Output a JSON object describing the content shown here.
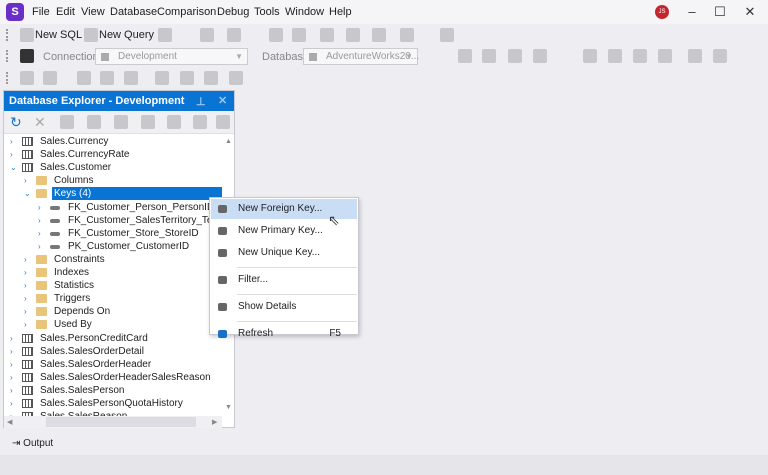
{
  "app": {
    "logo": "S",
    "avatar": "JS"
  },
  "menu": [
    "File",
    "Edit",
    "View",
    "Database",
    "Comparison",
    "Debug",
    "Tools",
    "Window",
    "Help"
  ],
  "toolbar": {
    "new_sql": "New SQL",
    "new_query": "New Query",
    "connection_label": "Connection",
    "connection_value": "Development",
    "database_label": "Database",
    "database_value": "AdventureWorks20..."
  },
  "panel": {
    "title": "Database Explorer - Development",
    "accent": "#0a74d4"
  },
  "tree": [
    {
      "level": 0,
      "icon": "table",
      "label": "Sales.Currency",
      "expanded": false
    },
    {
      "level": 0,
      "icon": "table",
      "label": "Sales.CurrencyRate",
      "expanded": false
    },
    {
      "level": 0,
      "icon": "table",
      "label": "Sales.Customer",
      "expanded": true
    },
    {
      "level": 1,
      "icon": "folder",
      "label": "Columns",
      "expanded": false
    },
    {
      "level": 1,
      "icon": "folder",
      "label": "Keys (4)",
      "expanded": true,
      "selected": true
    },
    {
      "level": 2,
      "icon": "key",
      "label": "FK_Customer_Person_PersonID",
      "expanded": false
    },
    {
      "level": 2,
      "icon": "key",
      "label": "FK_Customer_SalesTerritory_TerritoryID",
      "expanded": false
    },
    {
      "level": 2,
      "icon": "key",
      "label": "FK_Customer_Store_StoreID",
      "expanded": false
    },
    {
      "level": 2,
      "icon": "key",
      "label": "PK_Customer_CustomerID",
      "expanded": false
    },
    {
      "level": 1,
      "icon": "folder",
      "label": "Constraints",
      "expanded": false
    },
    {
      "level": 1,
      "icon": "folder",
      "label": "Indexes",
      "expanded": false
    },
    {
      "level": 1,
      "icon": "folder",
      "label": "Statistics",
      "expanded": false
    },
    {
      "level": 1,
      "icon": "folder",
      "label": "Triggers",
      "expanded": false
    },
    {
      "level": 1,
      "icon": "folder",
      "label": "Depends On",
      "expanded": false
    },
    {
      "level": 1,
      "icon": "folder",
      "label": "Used By",
      "expanded": false
    },
    {
      "level": 0,
      "icon": "table",
      "label": "Sales.PersonCreditCard",
      "expanded": false
    },
    {
      "level": 0,
      "icon": "table",
      "label": "Sales.SalesOrderDetail",
      "expanded": false
    },
    {
      "level": 0,
      "icon": "table",
      "label": "Sales.SalesOrderHeader",
      "expanded": false
    },
    {
      "level": 0,
      "icon": "table",
      "label": "Sales.SalesOrderHeaderSalesReason",
      "expanded": false
    },
    {
      "level": 0,
      "icon": "table",
      "label": "Sales.SalesPerson",
      "expanded": false
    },
    {
      "level": 0,
      "icon": "table",
      "label": "Sales.SalesPersonQuotaHistory",
      "expanded": false
    },
    {
      "level": 0,
      "icon": "table",
      "label": "Sales.SalesReason",
      "expanded": false
    }
  ],
  "context_menu": [
    {
      "label": "New Foreign Key...",
      "icon": "foreign-key-icon",
      "highlighted": true
    },
    {
      "label": "New Primary Key...",
      "icon": "primary-key-icon"
    },
    {
      "label": "New Unique Key...",
      "icon": "unique-key-icon"
    },
    {
      "separator": true
    },
    {
      "label": "Filter...",
      "icon": "filter-icon"
    },
    {
      "separator": true
    },
    {
      "label": "Show Details",
      "icon": "details-icon"
    },
    {
      "separator": true
    },
    {
      "label": "Refresh",
      "icon": "refresh-icon",
      "shortcut": "F5"
    }
  ],
  "bottom": {
    "output": "Output"
  }
}
